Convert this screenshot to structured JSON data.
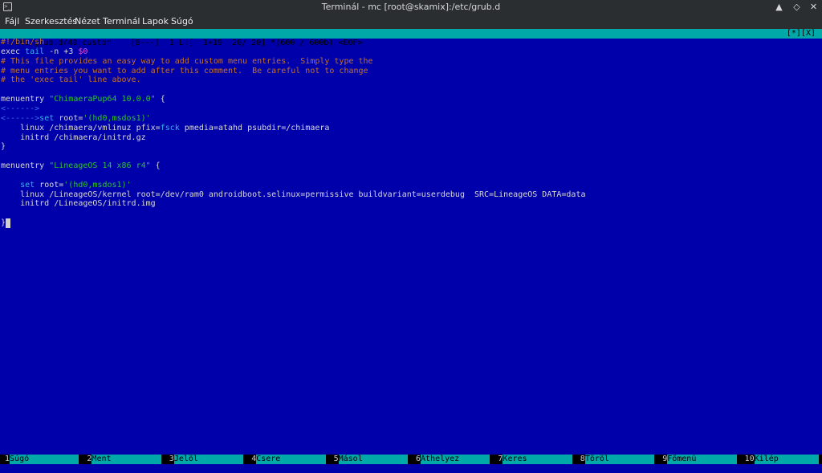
{
  "window": {
    "title": "Terminál - mc [root@skamix]:/etc/grub.d",
    "app_icon": "terminal-icon",
    "controls": [
      "minimize",
      "maximize",
      "close"
    ]
  },
  "menubar": [
    "Fájl",
    "Szerkesztés",
    "Nézet",
    "Terminál",
    "Lapok",
    "Súgó"
  ],
  "status": {
    "left": "/etc/grub.d/40_custom    [B---]  1 L:[  1+19  20/ 20] *(600 / 600b) <EOF>",
    "right": "[*][X]"
  },
  "editor": {
    "lines": [
      [
        {
          "t": "#!/bin/sh",
          "c": "comment"
        }
      ],
      [
        {
          "t": "exec ",
          "c": "white"
        },
        {
          "t": "tail",
          "c": "cyan"
        },
        {
          "t": " -n +3 ",
          "c": "white"
        },
        {
          "t": "$0",
          "c": "magenta"
        }
      ],
      [
        {
          "t": "# This file provides an easy way to add custom menu entries.  Simply type the",
          "c": "comment"
        }
      ],
      [
        {
          "t": "# menu entries you want to add after this comment.  Be careful not to change",
          "c": "comment"
        }
      ],
      [
        {
          "t": "# the 'exec tail' line above.",
          "c": "comment"
        }
      ],
      [],
      [
        {
          "t": "menuentry ",
          "c": "white"
        },
        {
          "t": "\"ChimaeraPup64 10.0.0\"",
          "c": "green"
        },
        {
          "t": " {",
          "c": "white"
        }
      ],
      [
        {
          "t": "<------>",
          "c": "blue"
        }
      ],
      [
        {
          "t": "<------>",
          "c": "blue"
        },
        {
          "t": "set",
          "c": "cyan"
        },
        {
          "t": " root=",
          "c": "white"
        },
        {
          "t": "'(hd0,msdos1)'",
          "c": "green"
        }
      ],
      [
        {
          "t": "    linux /chimaera/vmlinuz pfix=",
          "c": "white"
        },
        {
          "t": "fsck",
          "c": "cyan"
        },
        {
          "t": " pmedia=atahd psubdir=/chimaera",
          "c": "white"
        }
      ],
      [
        {
          "t": "    initrd /chimaera/initrd.gz",
          "c": "white"
        }
      ],
      [
        {
          "t": "}",
          "c": "white"
        }
      ],
      [],
      [
        {
          "t": "menuentry ",
          "c": "white"
        },
        {
          "t": "\"LineageOS 14 x86 r4\"",
          "c": "green"
        },
        {
          "t": " {",
          "c": "white"
        }
      ],
      [],
      [
        {
          "t": "    ",
          "c": "white"
        },
        {
          "t": "set",
          "c": "cyan"
        },
        {
          "t": " root=",
          "c": "white"
        },
        {
          "t": "'(hd0,msdos1)'",
          "c": "green"
        }
      ],
      [
        {
          "t": "    linux /LineageOS/kernel root=/dev/ram0 androidboot.selinux=permissive buildvariant=userdebug  SRC=LineageOS DATA=data",
          "c": "white"
        }
      ],
      [
        {
          "t": "    initrd /LineageOS/initrd.img",
          "c": "white"
        }
      ],
      [],
      [
        {
          "t": "}",
          "c": "white"
        }
      ]
    ]
  },
  "fkeys": [
    {
      "num": "1",
      "label": "Súgó"
    },
    {
      "num": "2",
      "label": "Ment"
    },
    {
      "num": "3",
      "label": "Jelöl"
    },
    {
      "num": "4",
      "label": "Csere"
    },
    {
      "num": "5",
      "label": "Másol"
    },
    {
      "num": "6",
      "label": "Áthelyez"
    },
    {
      "num": "7",
      "label": "Keres"
    },
    {
      "num": "8",
      "label": "Töröl"
    },
    {
      "num": "9",
      "label": "Főmenü"
    },
    {
      "num": "10",
      "label": "Kilép"
    }
  ]
}
